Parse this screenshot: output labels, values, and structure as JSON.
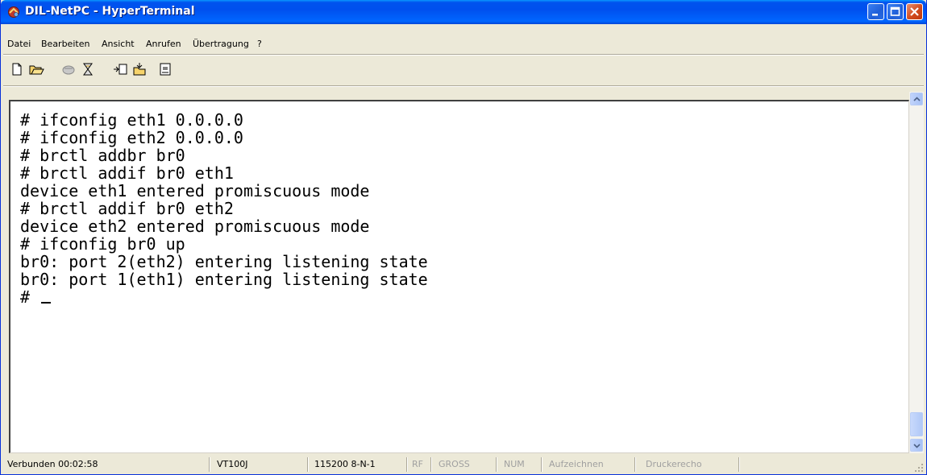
{
  "window": {
    "title": "DIL-NetPC - HyperTerminal"
  },
  "menu": [
    "Datei",
    "Bearbeiten",
    "Ansicht",
    "Anrufen",
    "Übertragung",
    "?"
  ],
  "toolbar": {
    "icons": [
      "new-file-icon",
      "open-folder-icon",
      "call-icon",
      "disconnect-icon",
      "send-icon",
      "receive-icon",
      "properties-icon"
    ]
  },
  "terminal": {
    "lines": [
      "# ifconfig eth1 0.0.0.0",
      "# ifconfig eth2 0.0.0.0",
      "# brctl addbr br0",
      "# brctl addif br0 eth1",
      "device eth1 entered promiscuous mode",
      "# brctl addif br0 eth2",
      "device eth2 entered promiscuous mode",
      "# ifconfig br0 up",
      "br0: port 2(eth2) entering listening state",
      "br0: port 1(eth1) entering listening state",
      "# "
    ]
  },
  "status": {
    "connection": "Verbunden 00:02:58",
    "emulation": "VT100J",
    "port_settings": "115200 8-N-1",
    "rf": "RF",
    "gross": "GROSS",
    "num": "NUM",
    "capture": "Aufzeichnen",
    "print_echo": "Druckerecho"
  },
  "colors": {
    "titlebar": "#0054E3",
    "chrome": "#ECE9D8",
    "terminal_bg": "#FFFFFF",
    "terminal_text": "#000000",
    "close_button": "#D14B1E"
  }
}
